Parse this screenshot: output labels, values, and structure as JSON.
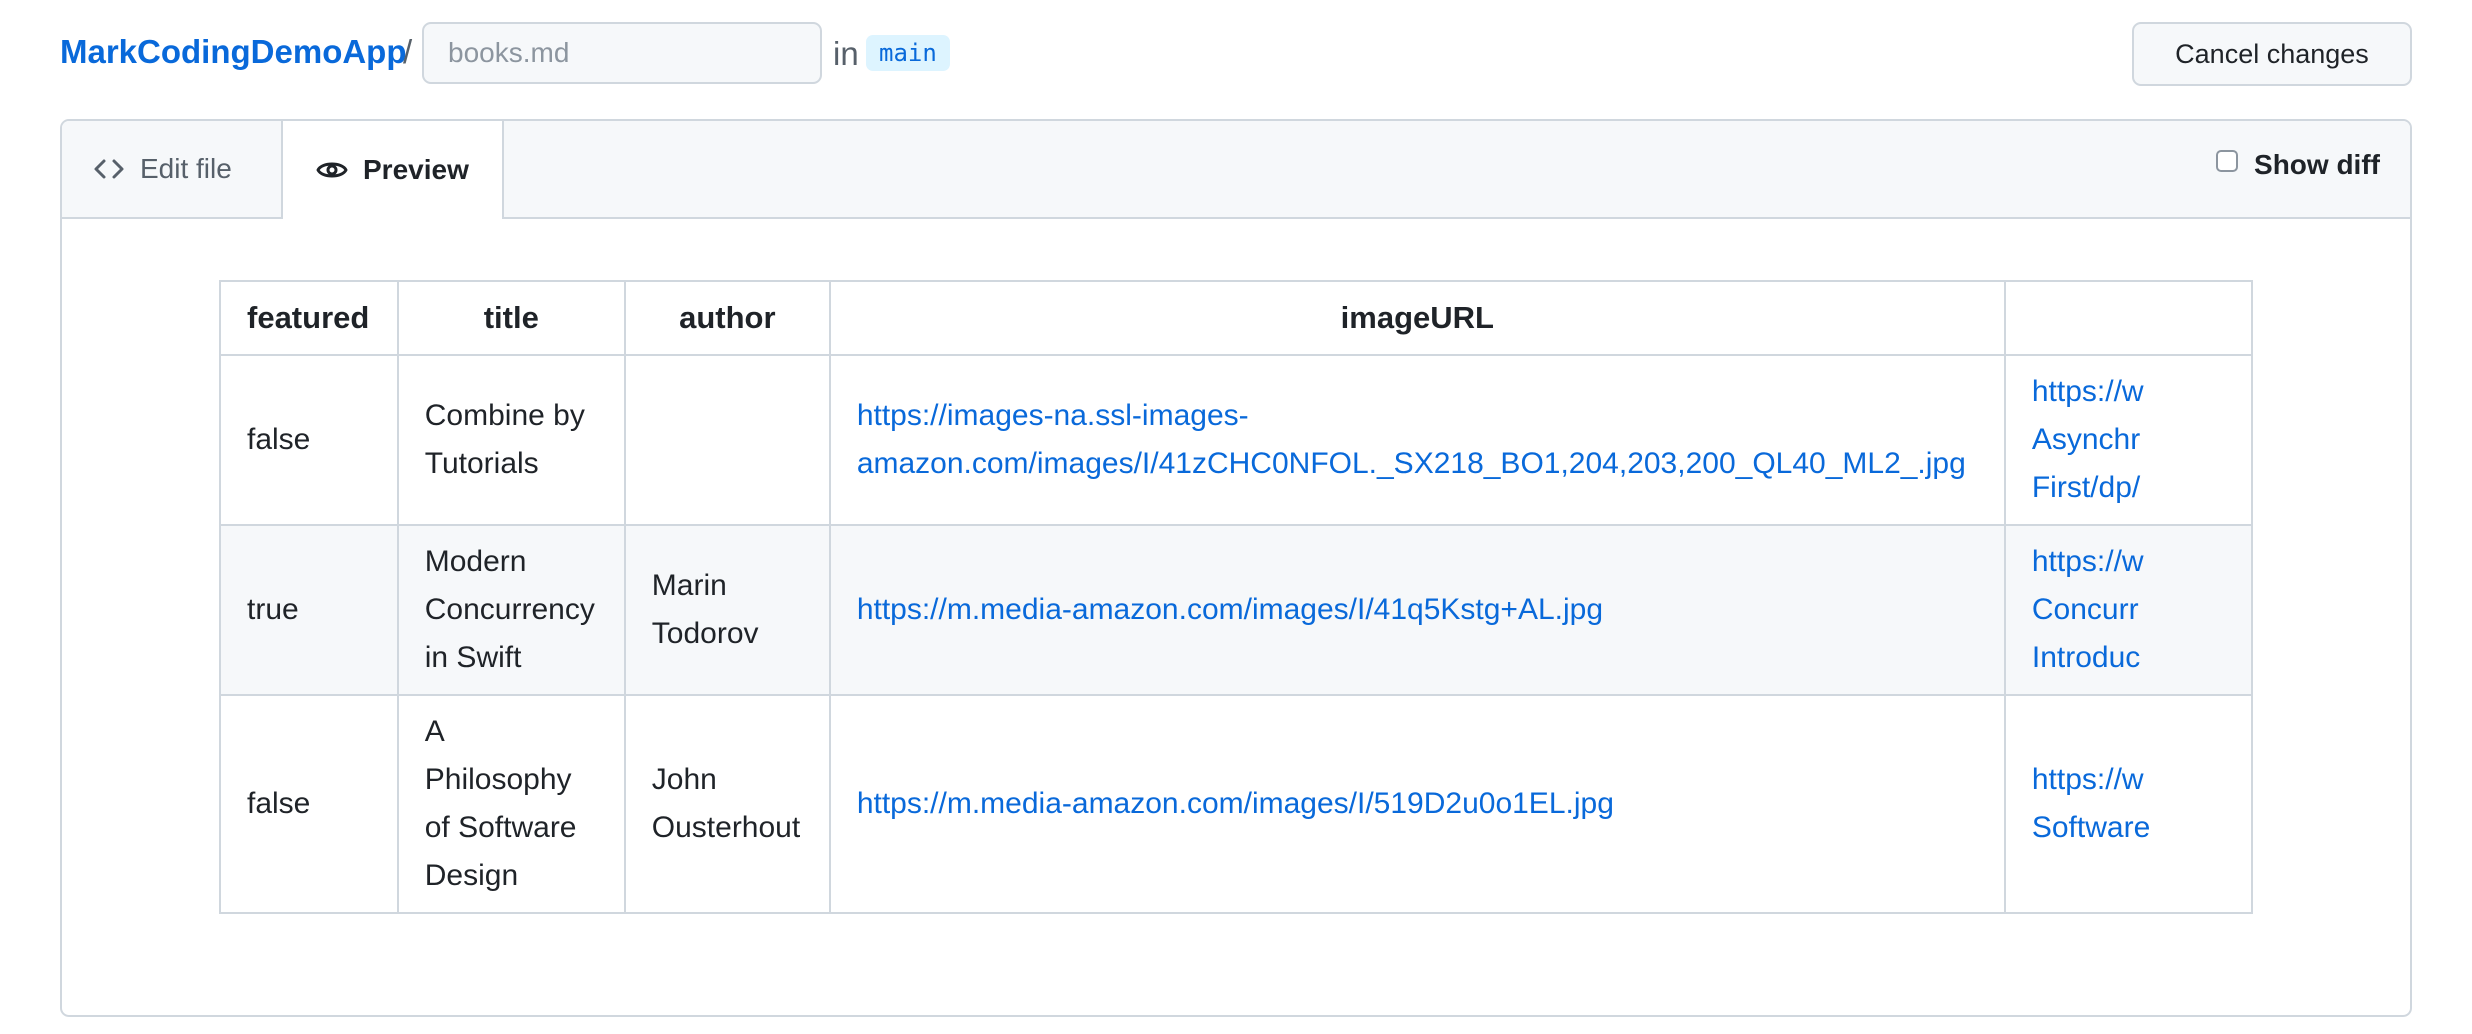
{
  "header": {
    "repo_name": "MarkCodingDemoApp",
    "separator": "/",
    "filename_placeholder": "books.md",
    "in_label": "in",
    "branch": "main",
    "cancel_label": "Cancel changes"
  },
  "tabs": {
    "edit_label": "Edit file",
    "preview_label": "Preview",
    "show_diff_label": "Show diff"
  },
  "table": {
    "headers": [
      "featured",
      "title",
      "author",
      "imageURL",
      ""
    ],
    "rows": [
      {
        "featured": "false",
        "title": "Combine by Tutorials",
        "author": "",
        "imageURL": "https://images-na.ssl-images-amazon.com/images/I/41zCHC0NFOL._SX218_BO1,204,203,200_QL40_ML2_.jpg",
        "url": "https://w Asynchr First/dp/"
      },
      {
        "featured": "true",
        "title": "Modern Concurrency in Swift",
        "author": "Marin Todorov",
        "imageURL": "https://m.media-amazon.com/images/I/41q5Kstg+AL.jpg",
        "url": "https://w Concurr Introduc"
      },
      {
        "featured": "false",
        "title": "A Philosophy of Software Design",
        "author": "John Ousterhout",
        "imageURL": "https://m.media-amazon.com/images/I/519D2u0o1EL.jpg",
        "url": "https://w Software"
      }
    ]
  }
}
